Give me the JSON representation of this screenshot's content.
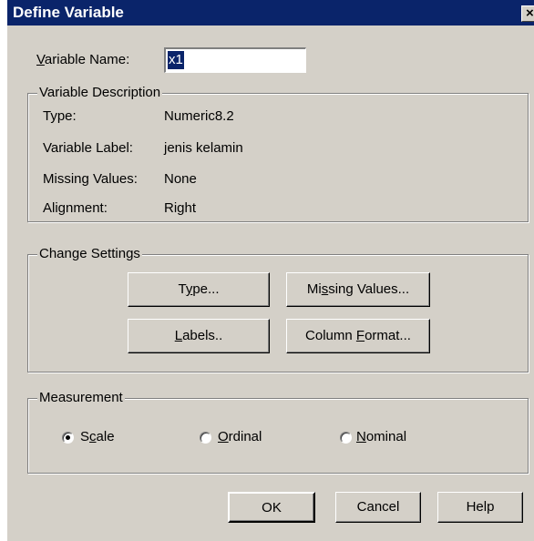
{
  "window": {
    "title": "Define Variable",
    "close_glyph": "×"
  },
  "variable_name": {
    "label_prefix": "",
    "label_mnemonic": "V",
    "label_rest": "ariable Name:",
    "value": "x1"
  },
  "description": {
    "title": "Variable Description",
    "rows": [
      {
        "label": "Type:",
        "value": "Numeric8.2"
      },
      {
        "label": "Variable Label:",
        "value": "jenis kelamin"
      },
      {
        "label": "Missing Values:",
        "value": "None"
      },
      {
        "label": "Alignment:",
        "value": "Right"
      }
    ]
  },
  "change_settings": {
    "title": "Change Settings",
    "buttons": {
      "type": {
        "prefix": "T",
        "mnemonic": "y",
        "suffix": "pe..."
      },
      "missing": {
        "prefix": "Mi",
        "mnemonic": "s",
        "suffix": "sing Values..."
      },
      "labels": {
        "prefix": "",
        "mnemonic": "L",
        "suffix": "abels.."
      },
      "column": {
        "prefix": "Column ",
        "mnemonic": "F",
        "suffix": "ormat..."
      }
    }
  },
  "measurement": {
    "title": "Measurement",
    "selected": "Scale",
    "options": {
      "scale": {
        "prefix": "S",
        "mnemonic": "c",
        "suffix": "ale",
        "selected": true
      },
      "ordinal": {
        "prefix": "",
        "mnemonic": "O",
        "suffix": "rdinal",
        "selected": false
      },
      "nominal": {
        "prefix": "",
        "mnemonic": "N",
        "suffix": "ominal",
        "selected": false
      }
    }
  },
  "actions": {
    "ok": "OK",
    "cancel": "Cancel",
    "help": "Help"
  },
  "colors": {
    "titlebar": "#0a246a",
    "face": "#d4d0c8",
    "selection": "#0a246a"
  },
  "icons": {
    "close": "close-icon",
    "radio_selected": "radio-selected-icon",
    "radio_unselected": "radio-unselected-icon"
  }
}
